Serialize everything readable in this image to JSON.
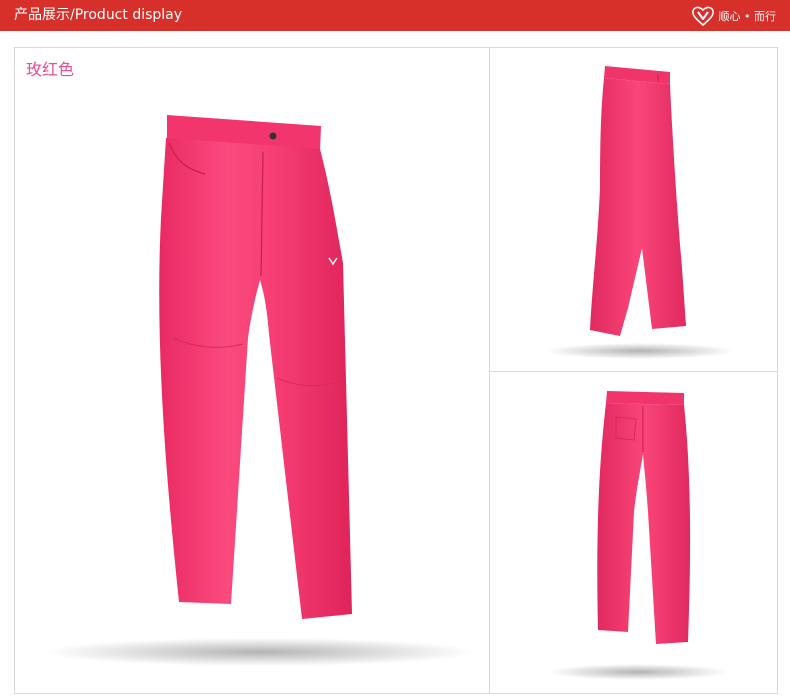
{
  "header": {
    "title": "产品展示/Product display",
    "brand_text": "顺心 • 而行",
    "brand_logo": "v-heart-logo",
    "background_color": "#d7302a"
  },
  "product": {
    "color_label": "玫红色",
    "color_label_color": "#ec4b8e",
    "pants_color": "#f6386f",
    "views": [
      "front-view-image",
      "side-view-image",
      "back-view-image"
    ]
  }
}
